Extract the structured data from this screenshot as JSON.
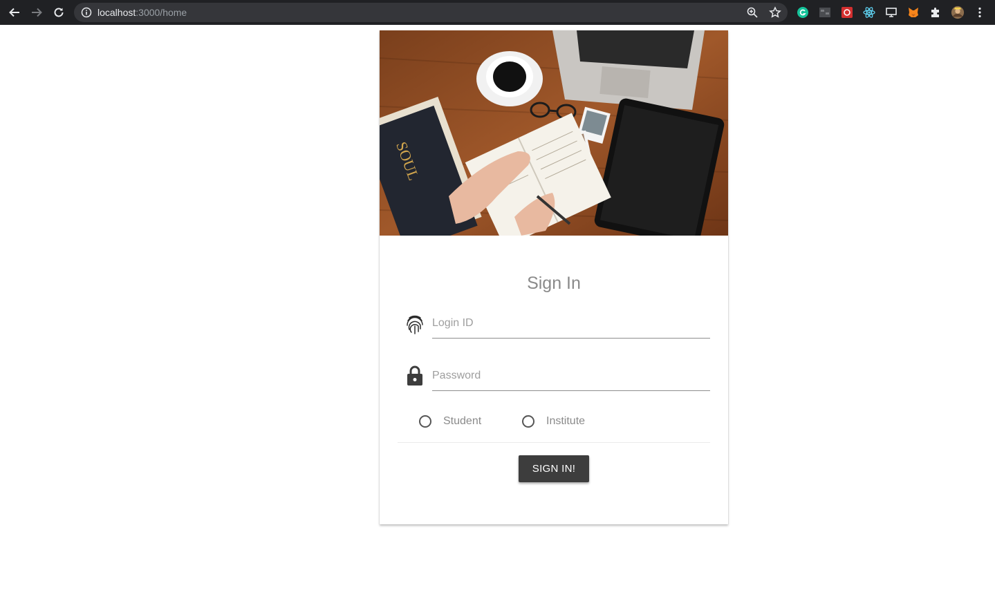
{
  "browser": {
    "url_host": "localhost",
    "url_path": ":3000/home"
  },
  "card": {
    "title": "Sign In",
    "login_placeholder": "Login ID",
    "password_placeholder": "Password",
    "role_options": [
      "Student",
      "Institute"
    ],
    "submit_label": "SIGN IN!"
  },
  "colors": {
    "chrome_bg": "#202124",
    "button_bg": "#3d3d3d",
    "title_text": "#8a8a8a"
  },
  "icons": {
    "login": "fingerprint-icon",
    "password": "lock-icon"
  }
}
